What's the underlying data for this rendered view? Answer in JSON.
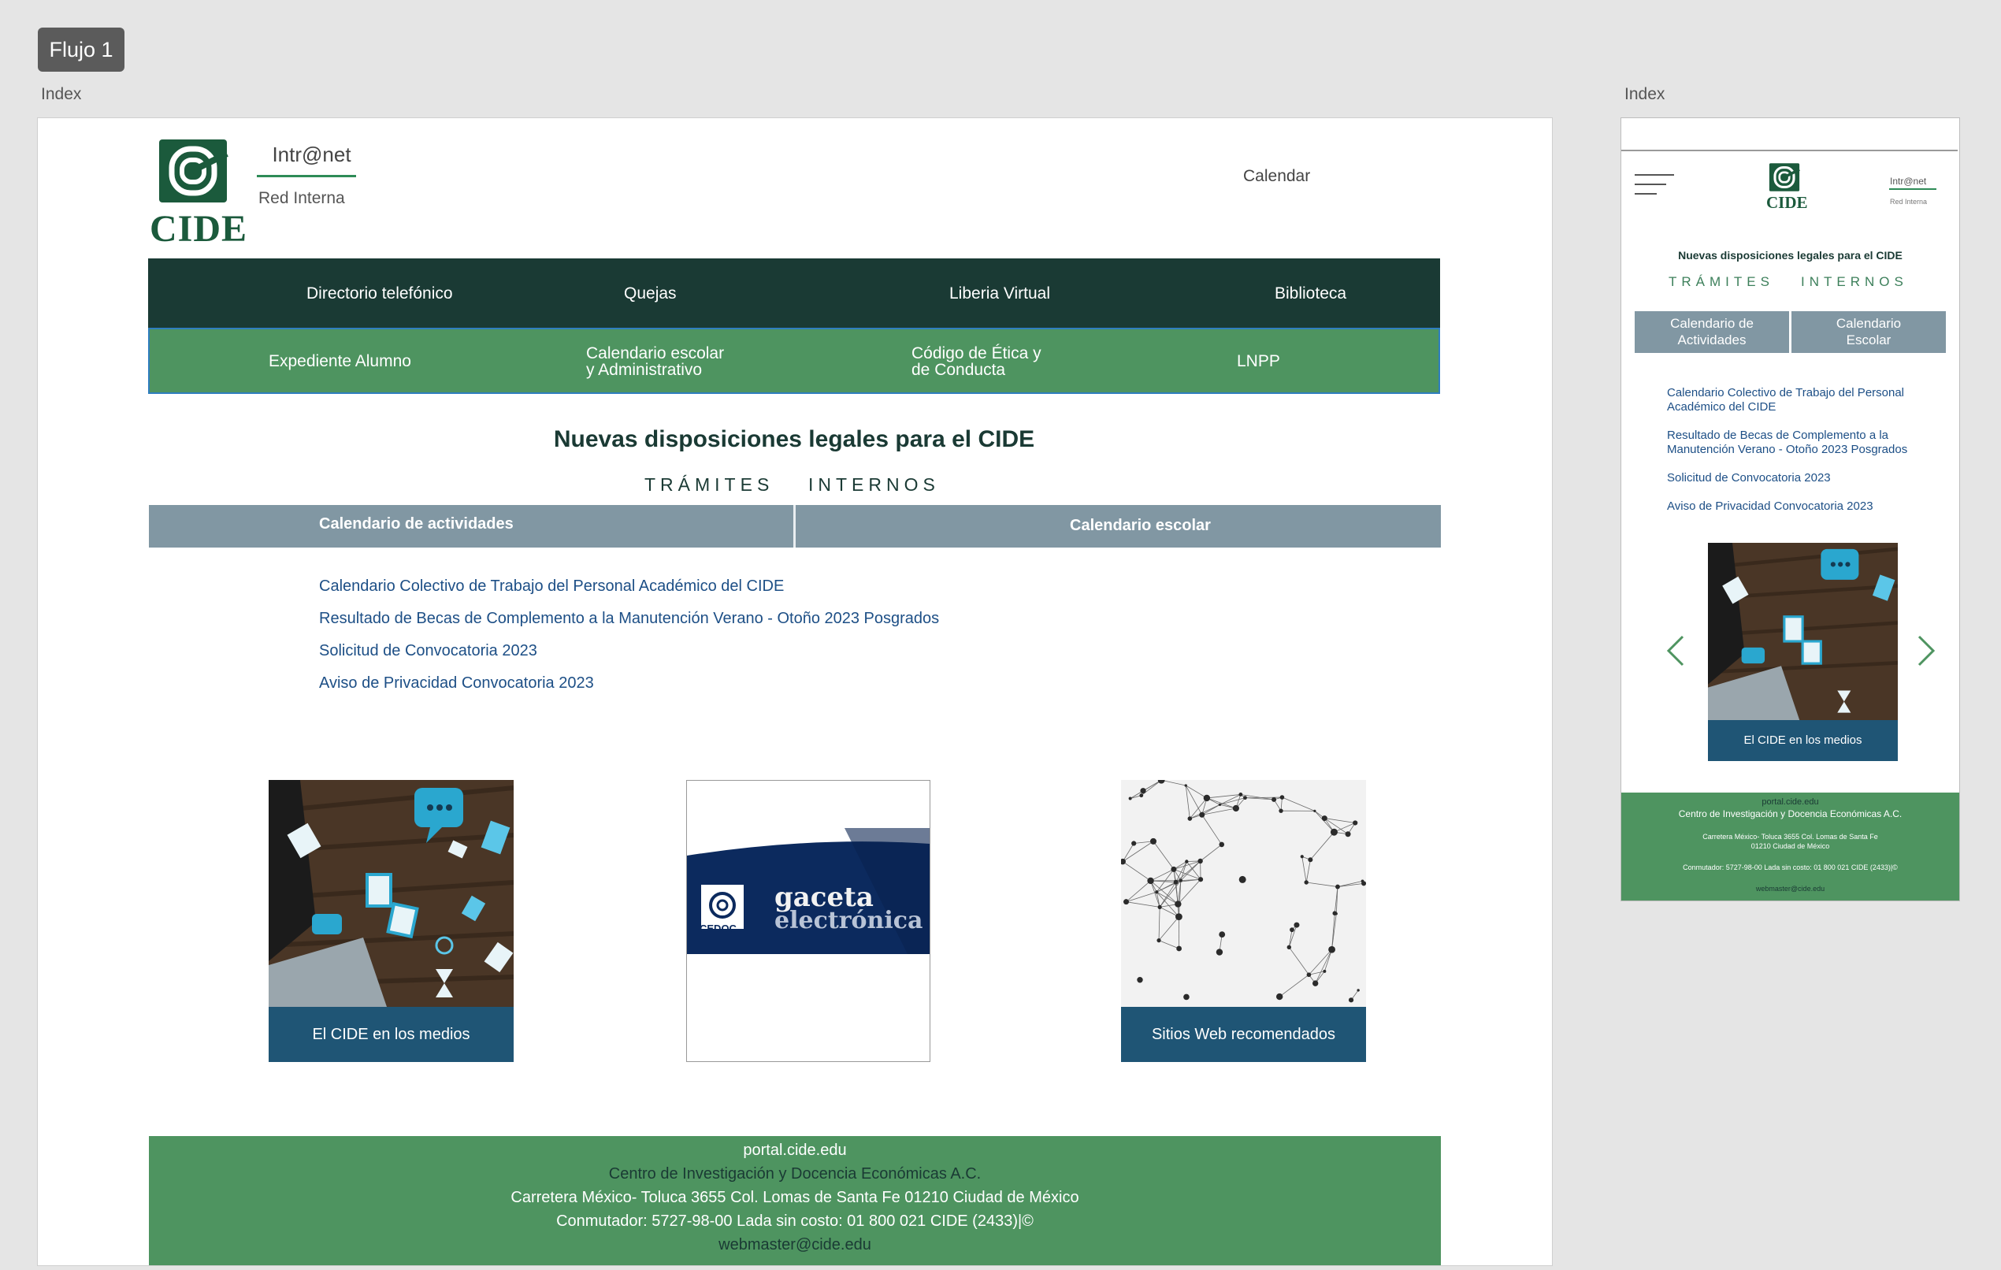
{
  "canvas": {
    "flow_badge": "Flujo 1",
    "desktop_label": "Index",
    "mobile_label": "Index"
  },
  "header": {
    "logo_text": "CIDE",
    "intranet": "Intr@net",
    "red_interna": "Red Interna",
    "calendar": "Calendar"
  },
  "nav": {
    "row1": [
      "Directorio telefónico",
      "Quejas",
      "Liberia Virtual",
      "Biblioteca"
    ],
    "row2": [
      [
        "Expediente Alumno",
        ""
      ],
      [
        "Calendario escolar",
        "y Administrativo"
      ],
      [
        "Código de Ética y",
        "de Conducta"
      ],
      [
        "LNPP",
        ""
      ]
    ]
  },
  "main": {
    "title": "Nuevas disposiciones legales para el CIDE",
    "tramites": "TRÁMITES",
    "internos": "INTERNOS",
    "tabs": [
      "Calendario de actividades",
      "Calendario escolar"
    ],
    "links": [
      "Calendario Colectivo de Trabajo del Personal Académico del CIDE",
      "Resultado de Becas de Complemento a la Manutención Verano - Otoño 2023 Posgrados",
      "Solicitud de Convocatoria 2023",
      "Aviso de Privacidad Convocatoria 2023"
    ],
    "cards": {
      "medios": "El CIDE en los medios",
      "gaceta_top": "gaceta",
      "gaceta_bottom": "electrónica",
      "cedoc": "CEDOC",
      "sitios": "Sitios Web recomendados"
    }
  },
  "footer": {
    "portal": "portal.cide.edu",
    "org": "Centro de Investigación y Docencia Económicas A.C.",
    "address": "Carretera México- Toluca 3655 Col. Lomas de Santa Fe 01210 Ciudad de México",
    "phone": "Conmutador: 5727-98-00 Lada sin costo: 01 800 021 CIDE (2433)|©",
    "email": "webmaster@cide.edu"
  },
  "mobile": {
    "logo_text": "CIDE",
    "intranet": "Intr@net",
    "red_interna": "Red Interna",
    "title": "Nuevas disposiciones legales para el CIDE",
    "tramites": "TRÁMITES",
    "internos": "INTERNOS",
    "tab1": [
      "Calendario de",
      "Actividades"
    ],
    "tab2": [
      "Calendario",
      "Escolar"
    ],
    "links": [
      [
        "Calendario Colectivo de Trabajo del Personal",
        "Académico del CIDE"
      ],
      [
        "Resultado de Becas de Complemento a la",
        "Manutención Verano - Otoño 2023 Posgrados"
      ],
      [
        "Solicitud de Convocatoria 2023",
        ""
      ],
      [
        "Aviso de Privacidad Convocatoria 2023",
        ""
      ]
    ],
    "carousel_caption": "El CIDE en los medios",
    "footer": {
      "portal": "portal.cide.edu",
      "org": "Centro de Investigación y Docencia Económicas A.C.",
      "address1": "Carretera México- Toluca 3655 Col. Lomas de Santa Fe",
      "address2": "01210 Ciudad de México",
      "phone": "Conmutador: 5727-98-00 Lada sin costo: 01 800 021 CIDE (2433)|©",
      "email": "webmaster@cide.edu"
    }
  },
  "colors": {
    "dark_green": "#1a3a34",
    "green": "#4e9460",
    "tab_gray": "#8197a3",
    "link_blue": "#1d4f86",
    "caption_blue": "#1f5575"
  }
}
